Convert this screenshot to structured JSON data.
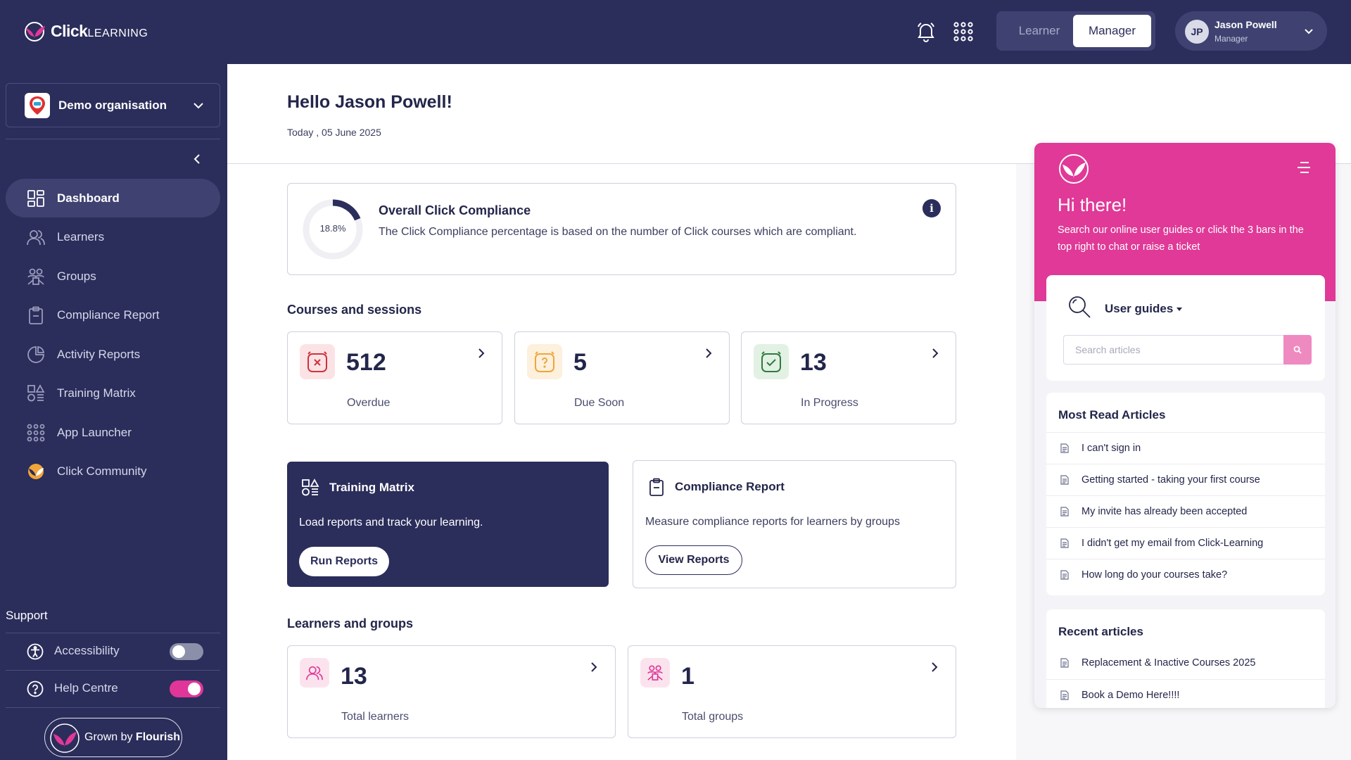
{
  "header": {
    "logo_brand": "Click",
    "logo_suffix": "LEARNING",
    "mode_learner": "Learner",
    "mode_manager": "Manager",
    "user": {
      "initials": "JP",
      "name": "Jason Powell",
      "role": "Manager"
    }
  },
  "sidebar": {
    "org_name": "Demo organisation",
    "items": [
      {
        "label": "Dashboard",
        "icon": "dashboard-icon",
        "active": true
      },
      {
        "label": "Learners",
        "icon": "learners-icon"
      },
      {
        "label": "Groups",
        "icon": "groups-icon"
      },
      {
        "label": "Compliance Report",
        "icon": "clipboard-icon"
      },
      {
        "label": "Activity Reports",
        "icon": "activity-icon"
      },
      {
        "label": "Training Matrix",
        "icon": "matrix-icon"
      },
      {
        "label": "App Launcher",
        "icon": "apps-grid-icon"
      },
      {
        "label": "Click Community",
        "icon": "community-icon"
      }
    ],
    "support_title": "Support",
    "accessibility_label": "Accessibility",
    "accessibility_on": false,
    "help_label": "Help Centre",
    "help_on": true,
    "grown_by": "Grown by",
    "flourish": "Flourish"
  },
  "main": {
    "greeting": "Hello Jason Powell!",
    "date": "Today , 05 June 2025",
    "compliance": {
      "percent_text": "18.8%",
      "percent": 18.8,
      "title": "Overall Click Compliance",
      "description": "The Click Compliance percentage is based on the number of Click courses which are compliant.",
      "info": "i"
    },
    "courses_title": "Courses and sessions",
    "courses": [
      {
        "value": "512",
        "label": "Overdue",
        "icon": "overdue-clock-icon"
      },
      {
        "value": "5",
        "label": "Due Soon",
        "icon": "due-soon-clock-icon"
      },
      {
        "value": "13",
        "label": "In Progress",
        "icon": "in-progress-clock-icon"
      }
    ],
    "training_matrix": {
      "title": "Training Matrix",
      "description": "Load reports and track your learning.",
      "button": "Run Reports"
    },
    "compliance_report": {
      "title": "Compliance Report",
      "description": "Measure compliance reports for learners by groups",
      "button": "View Reports"
    },
    "learners_title": "Learners and groups",
    "learners": {
      "value": "13",
      "label": "Total learners"
    },
    "groups": {
      "value": "1",
      "label": "Total groups"
    }
  },
  "widget": {
    "greeting": "Hi there!",
    "subtitle": "Search our online user guides or click the 3 bars in the top right to chat or raise a ticket",
    "guides_label": "User guides",
    "search_placeholder": "Search articles",
    "most_read_title": "Most Read Articles",
    "most_read": [
      "I can't sign in",
      "Getting started - taking your first course",
      "My invite has already been accepted",
      "I didn't get my email from Click-Learning",
      "How long do your courses take?"
    ],
    "recent_title": "Recent articles",
    "recent": [
      "Replacement & Inactive Courses 2025",
      "Book a Demo Here!!!!"
    ]
  },
  "colors": {
    "navy": "#2b2d5b",
    "pink": "#e03997",
    "overdue": "#d0323c",
    "due_soon": "#f0a63a",
    "in_progress": "#2f7a3e"
  }
}
